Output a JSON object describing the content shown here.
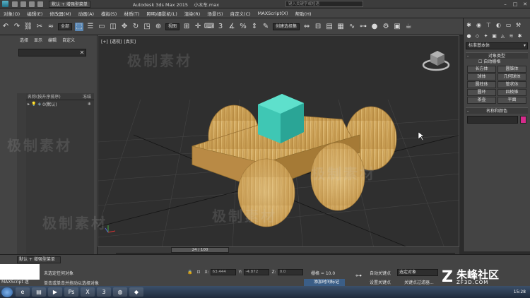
{
  "titlebar": {
    "workspace": "默认 + 增强型菜单",
    "app_title": "Autodesk 3ds Max  2015",
    "file_name": "小木车.max",
    "search_placeholder": "键入关键字或短语"
  },
  "menubar": {
    "items": [
      "对象(O)",
      "编辑(E)",
      "修改器(M)",
      "动画(A)",
      "模拟(S)",
      "材质(T)",
      "照明/摄影机(L)",
      "渲染(R)",
      "场景(S)",
      "自定义(C)",
      "MAXScript(X)",
      "帮助(H)"
    ]
  },
  "toolbar": {
    "filter_label": "全部",
    "view_label": "视图",
    "selection_set_placeholder": "创建选择集"
  },
  "scene_explorer": {
    "menu": [
      "选择",
      "显示",
      "编辑",
      "自定义"
    ],
    "columns": [
      "名称(按升序排序)",
      "冻结"
    ],
    "rows": [
      {
        "label": "0(默认)"
      }
    ]
  },
  "viewport": {
    "label": [
      "[+]",
      "[透视]",
      "[真实]"
    ]
  },
  "command_panel": {
    "category": "标准基本体",
    "object_type_title": "对象类型",
    "autogrid": "自动栅格",
    "objects": [
      "长方体",
      "圆锥体",
      "球体",
      "几何球体",
      "圆柱体",
      "管状体",
      "圆环",
      "四棱锥",
      "茶壶",
      "平面"
    ],
    "name_color_title": "名称和颜色",
    "color": "#d62b8c"
  },
  "timeline": {
    "frame_label": "24 / 100",
    "current_frame": 24,
    "total_frames": 100,
    "ticks": [
      "0",
      "10",
      "20",
      "30",
      "40",
      "50",
      "60",
      "70",
      "80",
      "90",
      "100"
    ]
  },
  "status": {
    "maxscript": "默认 + 增强型菜单",
    "maxscript_label": "MAXScript 迷",
    "line1": "未选定任何对象",
    "line2": "单击或单击并拖动以选择对象",
    "x_label": "X:",
    "x_value": "63.444",
    "y_label": "Y:",
    "y_value": "-4.872",
    "z_label": "Z:",
    "z_value": "0.0",
    "grid": "栅格 = 10.0",
    "add_time_tag": "添加时间标记",
    "auto_key": "自动关键点",
    "set_key": "设置关键点",
    "selected": "选定对象",
    "key_filters": "关键点过滤器..."
  },
  "taskbar": {
    "time": "15:28",
    "date": "2016/..."
  },
  "watermarks": {
    "text": "极制素材",
    "brand": "朱峰社区",
    "brand_url": "ZF3D.COM"
  }
}
